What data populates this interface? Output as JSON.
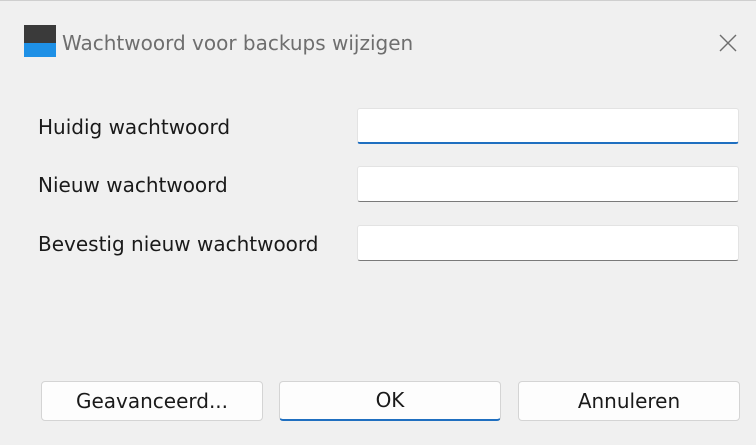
{
  "window": {
    "title": "Wachtwoord voor backups wijzigen",
    "icon": "app-icon",
    "close_icon": "close-icon"
  },
  "form": {
    "fields": [
      {
        "label": "Huidig wachtwoord",
        "value": "",
        "focused": true
      },
      {
        "label": "Nieuw wachtwoord",
        "value": ""
      },
      {
        "label": "Bevestig nieuw wachtwoord",
        "value": ""
      }
    ]
  },
  "buttons": {
    "advanced": "Geavanceerd...",
    "ok": "OK",
    "cancel": "Annuleren"
  },
  "colors": {
    "accent": "#1f6fc0",
    "background": "#f0f0f0",
    "icon_blue": "#1e90e6",
    "icon_dark": "#3a3a3a"
  }
}
